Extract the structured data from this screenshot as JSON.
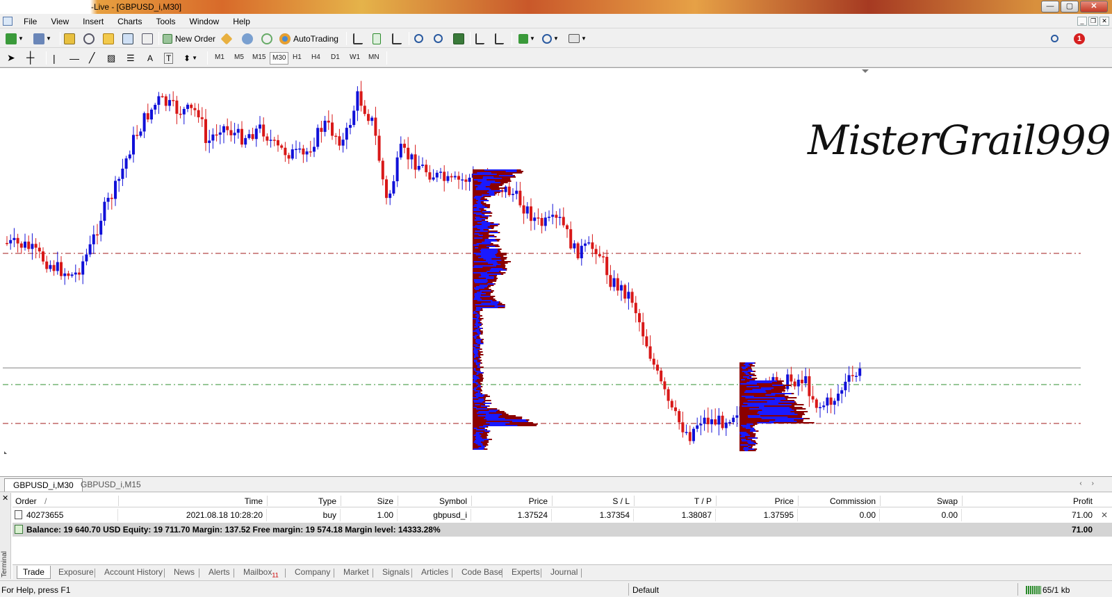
{
  "window": {
    "title": "-Live - [GBPUSD_i,M30]",
    "minimize": "—",
    "maximize": "▢",
    "close": "✕"
  },
  "menu": {
    "items": [
      {
        "label": "File"
      },
      {
        "label": "View"
      },
      {
        "label": "Insert"
      },
      {
        "label": "Charts"
      },
      {
        "label": "Tools"
      },
      {
        "label": "Window"
      },
      {
        "label": "Help"
      }
    ]
  },
  "toolbar": {
    "new_order_label": "New Order",
    "autotrading_label": "AutoTrading",
    "text_tool": "A",
    "notification_count": "1",
    "timeframes": [
      "M1",
      "M5",
      "M15",
      "M30",
      "H1",
      "H4",
      "D1",
      "W1",
      "MN"
    ],
    "active_timeframe": "M30"
  },
  "chart": {
    "symbol": "GBPUSD_i",
    "timeframe": "M30",
    "watermark": "MisterGrail999©",
    "colors": {
      "bull": "#1010d8",
      "bear": "#d81818",
      "profile_dark": "#8b0000",
      "profile_blue": "#1a1aff",
      "level_red": "#a01818",
      "level_green": "#2f8f2f",
      "grid_line": "#808080"
    }
  },
  "chart_tabs": [
    {
      "label": "GBPUSD_i,M30",
      "active": true
    },
    {
      "label": "GBPUSD_i,M15",
      "active": false
    }
  ],
  "terminal": {
    "side_label": "Terminal",
    "columns": {
      "order": "Order",
      "sort_indicator": "/",
      "time": "Time",
      "type": "Type",
      "size": "Size",
      "symbol": "Symbol",
      "price": "Price",
      "sl": "S / L",
      "tp": "T / P",
      "price2": "Price",
      "commission": "Commission",
      "swap": "Swap",
      "profit": "Profit"
    },
    "row": {
      "order": "40273655",
      "time": "2021.08.18 10:28:20",
      "type": "buy",
      "size": "1.00",
      "symbol": "gbpusd_i",
      "price": "1.37524",
      "sl": "1.37354",
      "tp": "1.38087",
      "price2": "1.37595",
      "commission": "0.00",
      "swap": "0.00",
      "profit": "71.00"
    },
    "balance_text": "Balance: 19 640.70 USD  Equity: 19 711.70  Margin: 137.52  Free margin: 19 574.18  Margin level: 14333.28%",
    "balance_profit": "71.00",
    "tabs": [
      {
        "label": "Trade",
        "active": true
      },
      {
        "label": "Exposure"
      },
      {
        "label": "Account History"
      },
      {
        "label": "News"
      },
      {
        "label": "Alerts"
      },
      {
        "label": "Mailbox",
        "badge": "11"
      },
      {
        "label": "Company"
      },
      {
        "label": "Market"
      },
      {
        "label": "Signals"
      },
      {
        "label": "Articles"
      },
      {
        "label": "Code Base"
      },
      {
        "label": "Experts"
      },
      {
        "label": "Journal"
      }
    ]
  },
  "status": {
    "help": "For Help, press F1",
    "profile": "Default",
    "traffic": "65/1 kb"
  }
}
